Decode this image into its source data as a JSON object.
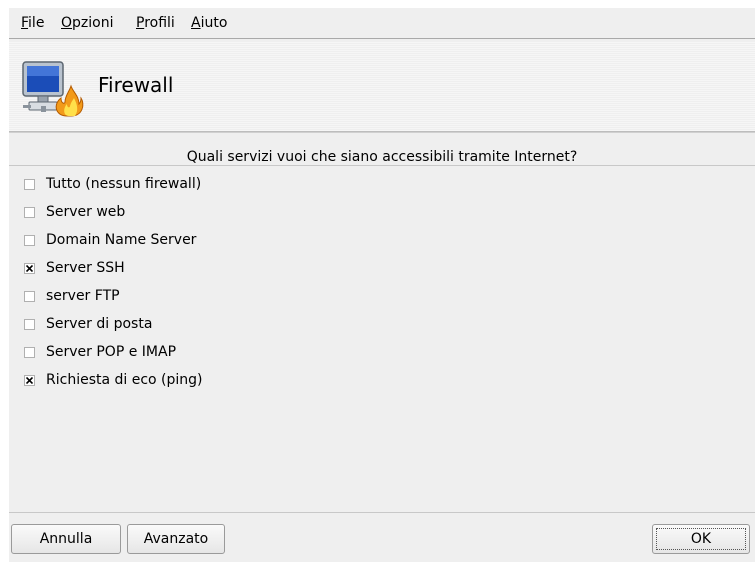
{
  "menubar": {
    "items": [
      {
        "mnemonic": "F",
        "rest": "ile"
      },
      {
        "mnemonic": "O",
        "rest": "pzioni"
      },
      {
        "mnemonic": "P",
        "rest": "rofili"
      },
      {
        "mnemonic": "A",
        "rest": "iuto"
      }
    ]
  },
  "banner": {
    "title": "Firewall",
    "icon": "firewall-computer-icon"
  },
  "prompt": "Quali servizi vuoi che siano accessibili tramite Internet?",
  "options": [
    {
      "label": "Tutto (nessun firewall)",
      "checked": false
    },
    {
      "label": "Server web",
      "checked": false
    },
    {
      "label": "Domain Name Server",
      "checked": false
    },
    {
      "label": "Server SSH",
      "checked": true
    },
    {
      "label": "server FTP",
      "checked": false
    },
    {
      "label": "Server di posta",
      "checked": false
    },
    {
      "label": "Server POP e IMAP",
      "checked": false
    },
    {
      "label": "Richiesta di eco (ping)",
      "checked": true
    }
  ],
  "buttons": {
    "cancel": "Annulla",
    "advanced": "Avanzato",
    "ok": "OK"
  }
}
